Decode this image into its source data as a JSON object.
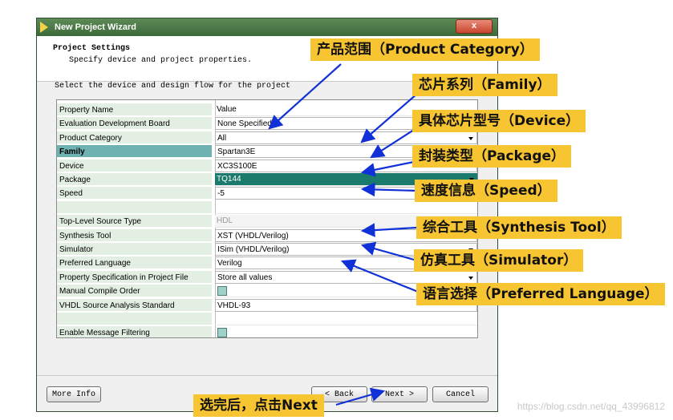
{
  "window": {
    "title": "New Project Wizard",
    "close_label": "x",
    "header_title": "Project Settings",
    "header_subtitle": "Specify device and project properties.",
    "instruction": "Select the device and design flow for the project"
  },
  "grid": {
    "rows": [
      {
        "label": "Property Name",
        "value": "Value",
        "style": "header"
      },
      {
        "label": "Evaluation Development Board",
        "value": "None Specified",
        "style": "boxed"
      },
      {
        "label": "Product Category",
        "value": "All",
        "style": "boxed-dd"
      },
      {
        "label": "Family",
        "value": "Spartan3E",
        "style": "selected"
      },
      {
        "label": "Device",
        "value": "XC3S100E",
        "style": "boxed"
      },
      {
        "label": "Package",
        "value": "TQ144",
        "style": "highlight-dd"
      },
      {
        "label": "Speed",
        "value": "-5",
        "style": "boxed"
      },
      {
        "label": "",
        "value": "",
        "style": "empty"
      },
      {
        "label": "Top-Level Source Type",
        "value": "HDL",
        "style": "gray"
      },
      {
        "label": "Synthesis Tool",
        "value": "XST (VHDL/Verilog)",
        "style": "boxed"
      },
      {
        "label": "Simulator",
        "value": "ISim (VHDL/Verilog)",
        "style": "boxed-dd"
      },
      {
        "label": "Preferred Language",
        "value": "Verilog",
        "style": "boxed"
      },
      {
        "label": "Property Specification in Project File",
        "value": "Store all values",
        "style": "boxed-dd"
      },
      {
        "label": "Manual Compile Order",
        "value": "",
        "style": "checkbox"
      },
      {
        "label": "VHDL Source Analysis Standard",
        "value": "VHDL-93",
        "style": "boxed"
      },
      {
        "label": "",
        "value": "",
        "style": "empty"
      },
      {
        "label": "Enable Message Filtering",
        "value": "",
        "style": "checkbox"
      }
    ]
  },
  "buttons": {
    "more_info": "More Info",
    "back": "< Back",
    "next": "Next >",
    "cancel": "Cancel"
  },
  "callouts": {
    "product_category": "产品范围（Product Category）",
    "family": "芯片系列（Family）",
    "device": "具体芯片型号（Device）",
    "package": "封装类型（Package）",
    "speed": "速度信息（Speed）",
    "synthesis": "综合工具（Synthesis Tool）",
    "simulator": "仿真工具（Simulator）",
    "language": "语言选择（Preferred Language）",
    "next": "选完后，点击Next"
  },
  "watermark": "https://blog.csdn.net/qq_43996812",
  "colors": {
    "callout_bg": "#f7c531",
    "arrow": "#1030d8",
    "highlight": "#1a7b6c",
    "selected_label": "#6fb2b2"
  }
}
